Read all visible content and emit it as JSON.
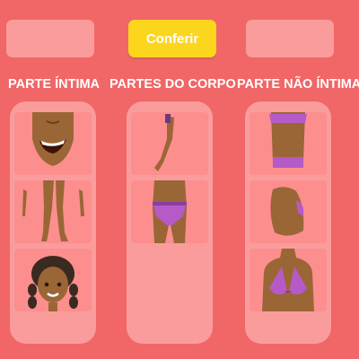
{
  "header": {
    "button_label": "Conferir"
  },
  "columns": {
    "left": {
      "title": "PARTE ÍNTIMA"
    },
    "middle": {
      "title": "PARTES DO CORPO"
    },
    "right": {
      "title": "PARTE NÃO ÍNTIMA"
    }
  },
  "colors": {
    "background": "#f16666",
    "panel": "#fa9c9c",
    "card": "#fd8e8e",
    "button": "#fbd61c",
    "skin": "#9a6636",
    "bikini": "#b65ac8"
  }
}
